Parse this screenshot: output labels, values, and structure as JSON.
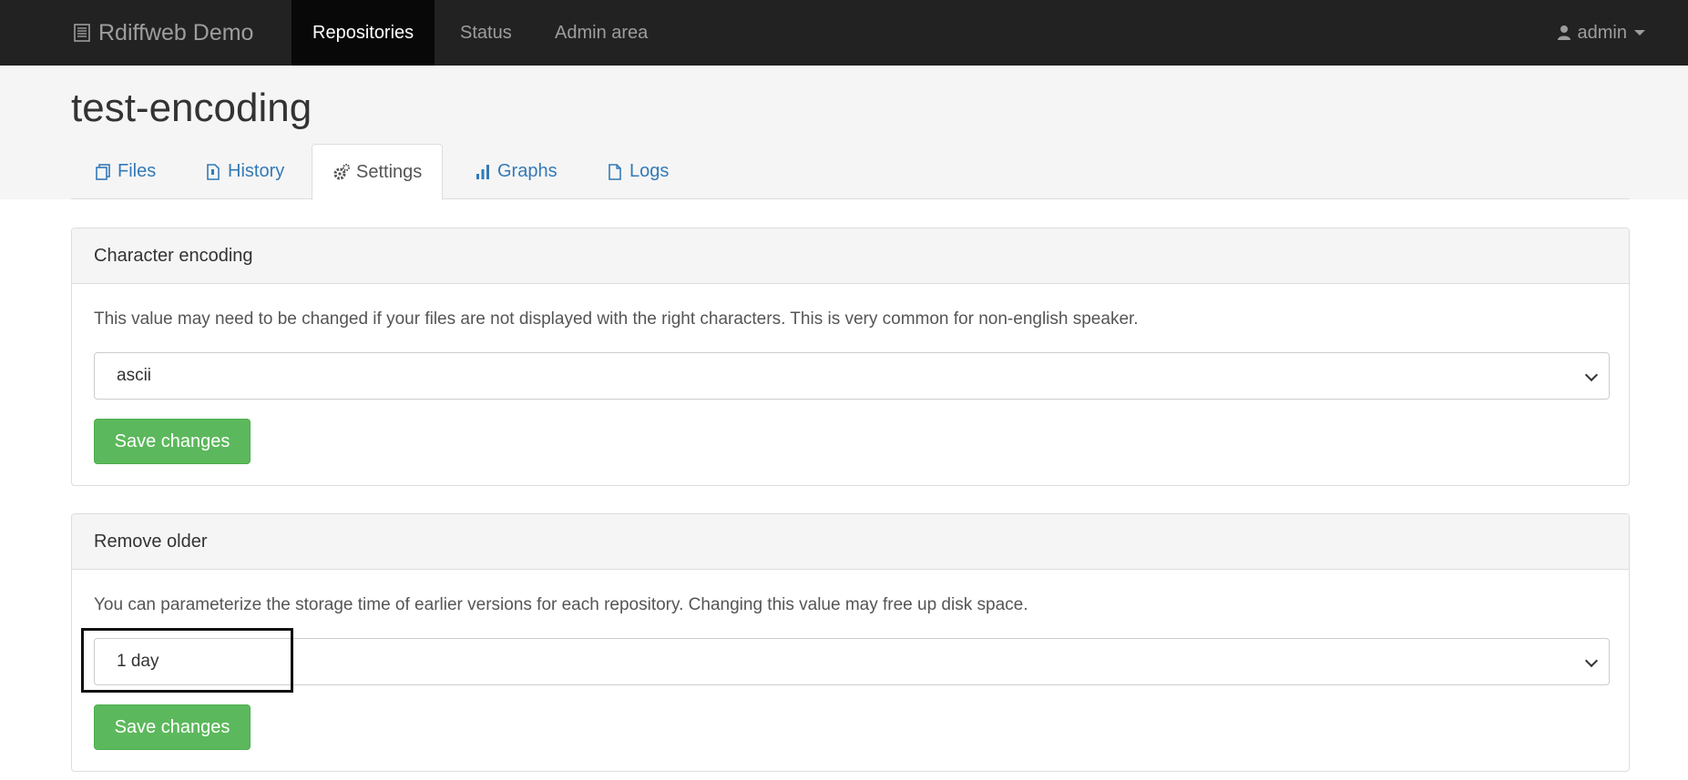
{
  "navbar": {
    "brand": "Rdiffweb Demo",
    "brand_icon": "server-icon",
    "items": [
      {
        "label": "Repositories",
        "active": true
      },
      {
        "label": "Status",
        "active": false
      },
      {
        "label": "Admin area",
        "active": false
      }
    ],
    "user": {
      "label": "admin",
      "icon": "user-icon"
    }
  },
  "page": {
    "title": "test-encoding"
  },
  "tabs": [
    {
      "label": "Files",
      "icon": "files-icon",
      "active": false
    },
    {
      "label": "History",
      "icon": "history-file-icon",
      "active": false
    },
    {
      "label": "Settings",
      "icon": "gears-icon",
      "active": true
    },
    {
      "label": "Graphs",
      "icon": "bar-chart-icon",
      "active": false
    },
    {
      "label": "Logs",
      "icon": "file-icon",
      "active": false
    }
  ],
  "encoding_panel": {
    "heading": "Character encoding",
    "help": "This value may need to be changed if your files are not displayed with the right characters. This is very common for non-english speaker.",
    "selected": "ascii",
    "save_label": "Save changes"
  },
  "remove_older_panel": {
    "heading": "Remove older",
    "help": "You can parameterize the storage time of earlier versions for each repository. Changing this value may free up disk space.",
    "selected": "1 day",
    "save_label": "Save changes"
  },
  "colors": {
    "navbar_bg": "#222222",
    "active_nav_bg": "#080808",
    "link": "#337ab7",
    "success": "#5cb85c"
  }
}
